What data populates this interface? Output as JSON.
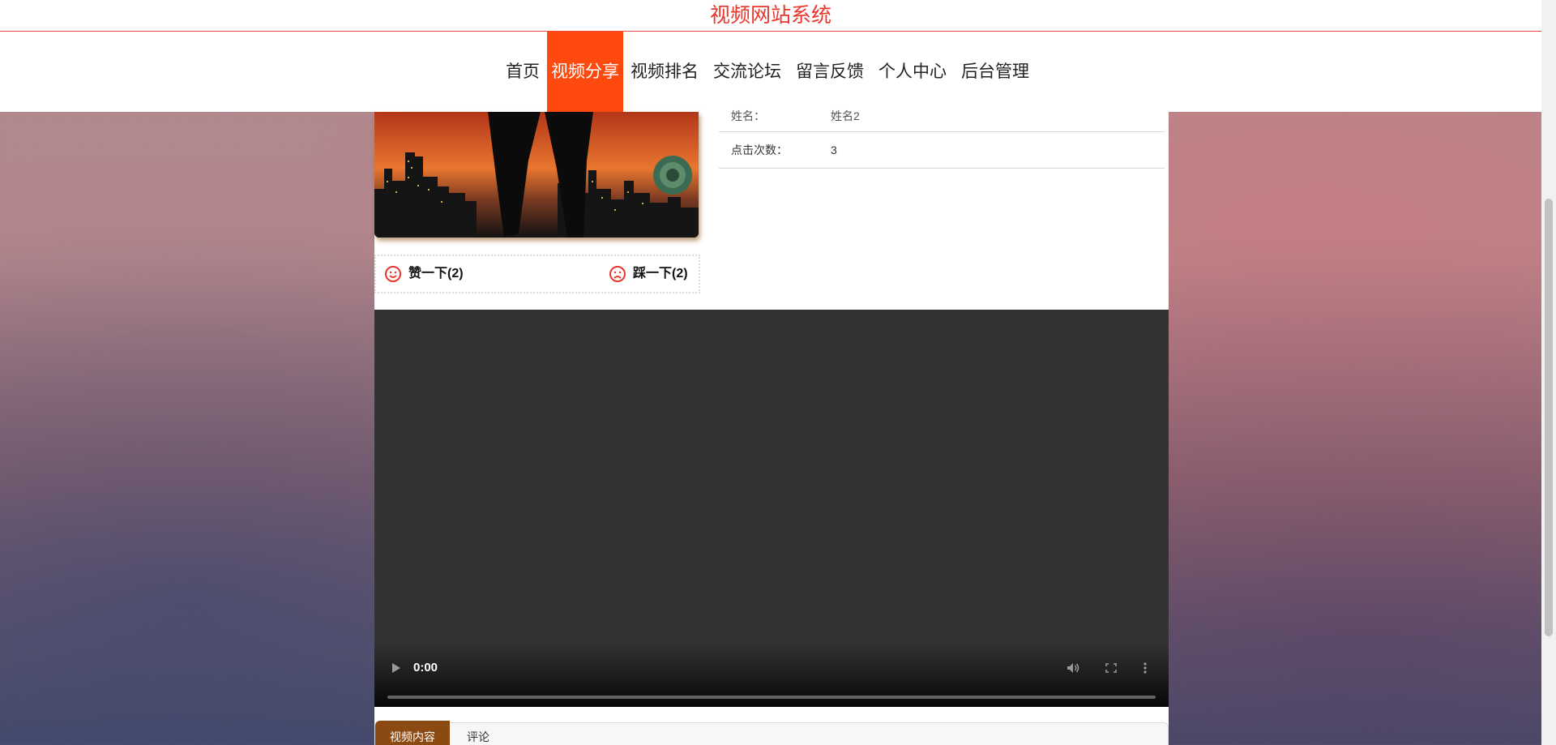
{
  "site": {
    "title": "视频网站系统"
  },
  "nav": {
    "items": [
      {
        "label": "首页"
      },
      {
        "label": "视频分享",
        "active": true
      },
      {
        "label": "视频排名"
      },
      {
        "label": "交流论坛"
      },
      {
        "label": "留言反馈"
      },
      {
        "label": "个人中心"
      },
      {
        "label": "后台管理"
      }
    ],
    "active_color": "#ff4a0f"
  },
  "votes": {
    "like_label": "赞一下(2)",
    "dislike_label": "踩一下(2)",
    "icon_color": "#e8362c"
  },
  "info": {
    "rows": [
      {
        "key": "姓名：",
        "value": "姓名2"
      },
      {
        "key": "点击次数：",
        "value": "3"
      }
    ]
  },
  "video": {
    "time": "0:00",
    "progress": 0
  },
  "tabs": [
    {
      "label": "视频内容",
      "active": true
    },
    {
      "label": "评论"
    }
  ],
  "colors": {
    "title": "#e8362c",
    "tab_active": "#8b4a12"
  }
}
